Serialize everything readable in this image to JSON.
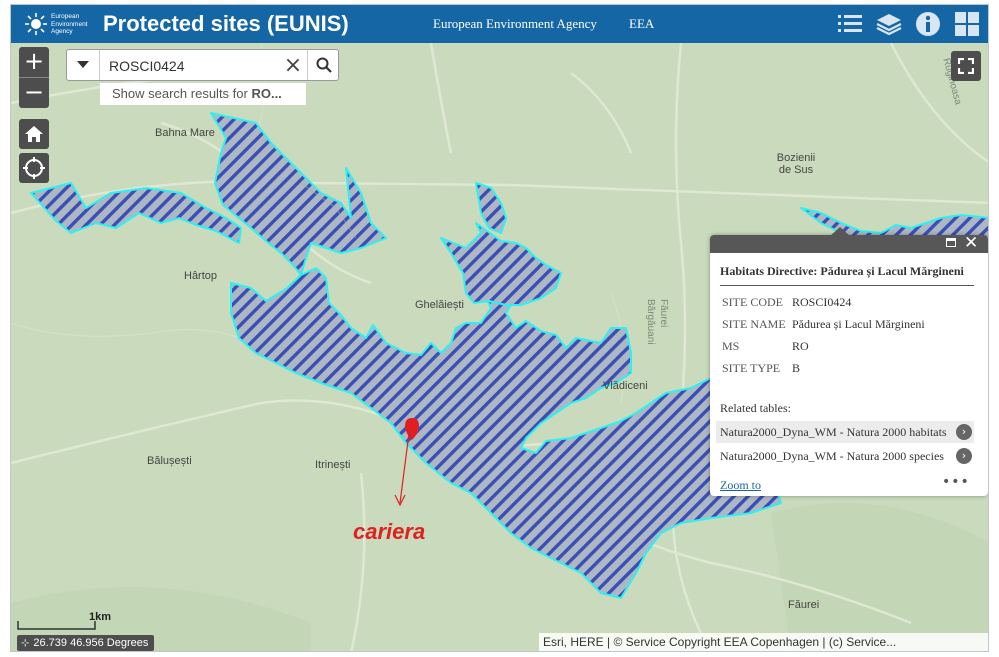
{
  "header": {
    "agency_logo_lines": [
      "European",
      "Environment",
      "Agency"
    ],
    "title": "Protected sites (EUNIS)",
    "links": [
      "European Environment Agency",
      "EEA"
    ],
    "icons": [
      "list-icon",
      "layers-icon",
      "info-icon",
      "apps-grid-icon"
    ]
  },
  "search": {
    "value": "ROSCI0424",
    "suggestion_prefix": "Show search results for ",
    "suggestion_term": "RO..."
  },
  "map": {
    "places": [
      "Bahna Mare",
      "Bozienii de Sus",
      "Hârtop",
      "Ghelăiești",
      "Vlădiceni",
      "Bălușești",
      "Itrinești",
      "Făurei"
    ],
    "road_labels": [
      "Făurei",
      "Bărgăuani",
      "Ruginoasa"
    ],
    "annotation": "cariera",
    "scale_label": "1km",
    "coordinates": "26.739 46.956 Degrees",
    "attribution": "Esri, HERE | © Service Copyright EEA Copenhagen | (c) Service..."
  },
  "popup": {
    "title": "Habitats Directive: Pădurea și Lacul Mărgineni",
    "fields": [
      {
        "key": "SITE CODE",
        "value": "ROSCI0424"
      },
      {
        "key": "SITE NAME",
        "value": "Pădurea și Lacul Mărgineni"
      },
      {
        "key": "MS",
        "value": "RO"
      },
      {
        "key": "SITE TYPE",
        "value": "B"
      }
    ],
    "related_label": "Related tables:",
    "related": [
      "Natura2000_Dyna_WM - Natura 2000 habitats",
      "Natura2000_Dyna_WM - Natura 2000 species"
    ],
    "zoom_link": "Zoom to",
    "more": "•••"
  },
  "colors": {
    "header_bg": "#1566a4",
    "map_bg": "#c9dbbc",
    "hatch": "#3a4fb5",
    "outline": "#2ff0f0",
    "marker": "#e02020"
  }
}
